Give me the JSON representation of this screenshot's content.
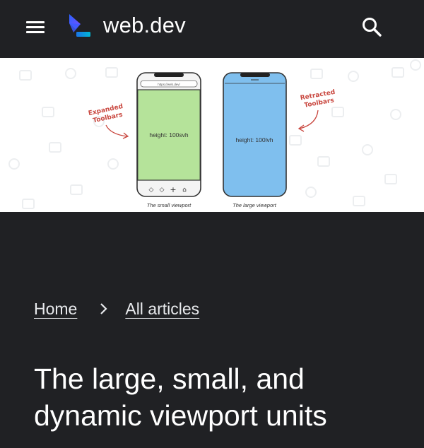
{
  "header": {
    "brand_name": "web.dev",
    "menu_icon": "hamburger-menu-icon",
    "search_icon": "search-icon",
    "logo_colors": [
      "#1a73e8",
      "#7c4dff",
      "#00b8d4"
    ]
  },
  "hero": {
    "url_text": "https://web.dev/",
    "left_phone_label": "height: 100svh",
    "right_phone_label": "height: 100lvh",
    "left_caption": "The small viewport",
    "right_caption": "The large viewport",
    "left_annotation_line1": "Expanded",
    "left_annotation_line2": "Toolbars",
    "right_annotation_line1": "Retracted",
    "right_annotation_line2": "Toolbars",
    "left_phone_color": "#b5e39a",
    "right_phone_color": "#7fbfee",
    "annotation_color": "#d9534f"
  },
  "breadcrumb": {
    "home": "Home",
    "separator": "›",
    "all_articles": "All articles"
  },
  "article": {
    "title": "The large, small, and dynamic viewport units"
  }
}
